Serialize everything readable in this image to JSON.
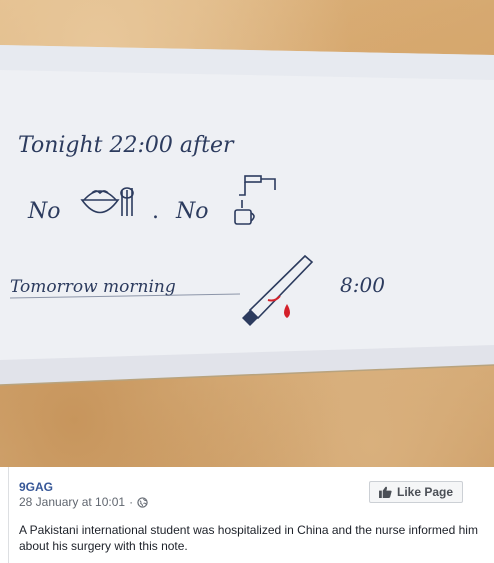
{
  "note": {
    "line1": "Tonight 22:00 after",
    "line2_no_1": "No",
    "line2_sep": ".",
    "line2_no_2": "No",
    "line3_a": "Tomorrow morning",
    "line3_time": "8:00"
  },
  "post": {
    "page_name": "9GAG",
    "date": "28 January at 10:01",
    "dot": "·",
    "like_label": "Like Page",
    "text": "A Pakistani international student was hospitalized in China and the nurse informed him about his surgery with this note."
  },
  "colors": {
    "link": "#385898",
    "ink": "#2c3b5e",
    "blood": "#d4202a"
  }
}
